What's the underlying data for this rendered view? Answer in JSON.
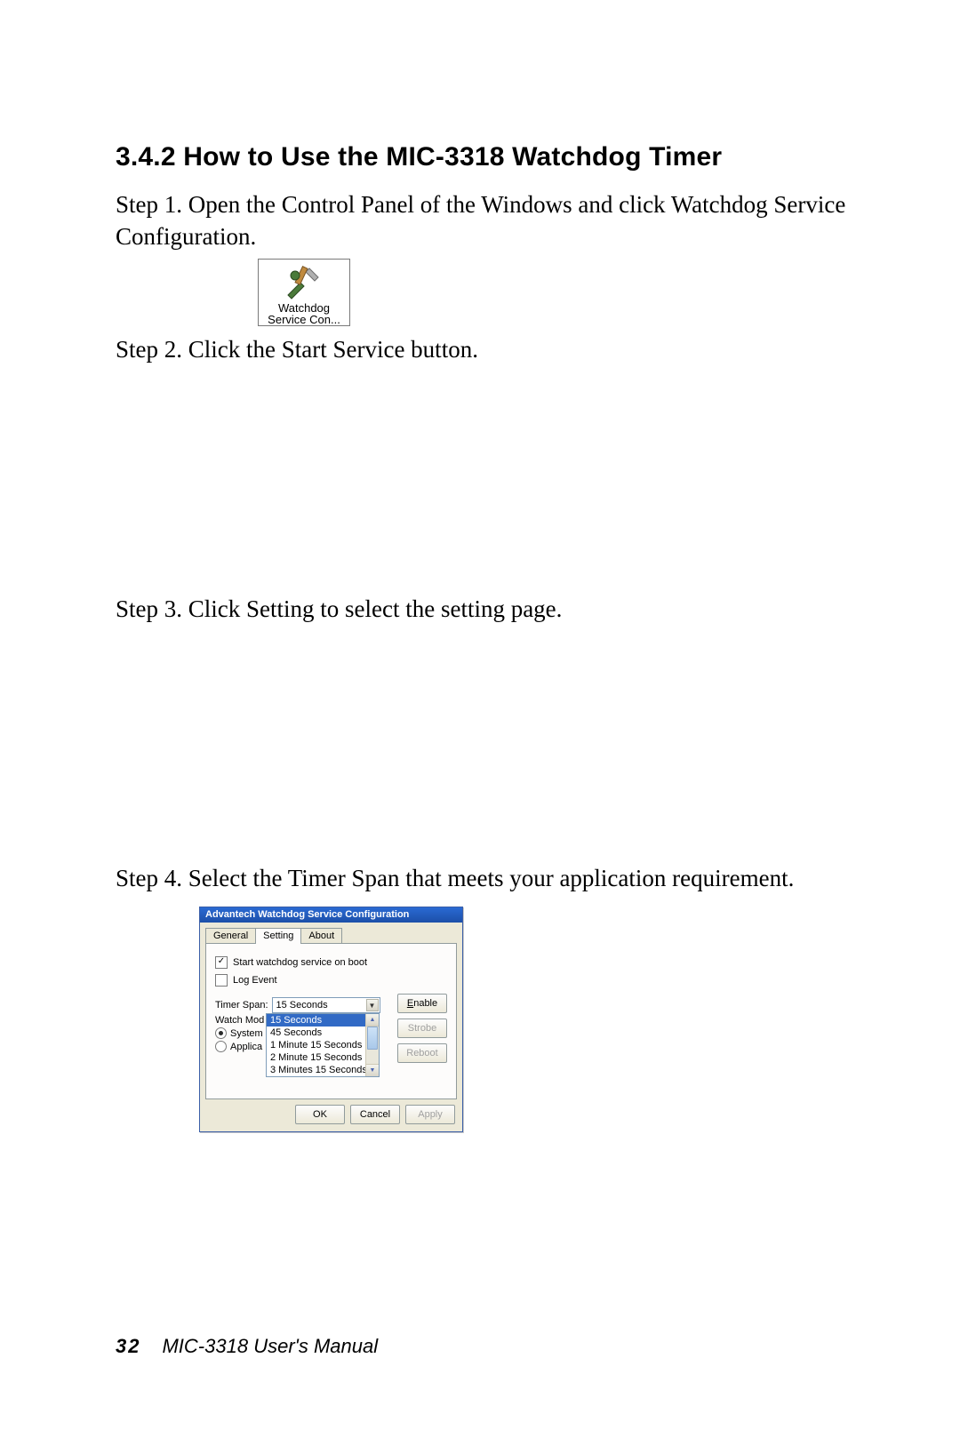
{
  "heading": "3.4.2 How to Use the MIC-3318 Watchdog Timer",
  "step1": "Step 1. Open the Control Panel of the Windows and click Watchdog Service Configuration.",
  "icon": {
    "line1": "Watchdog",
    "line2": "Service Con..."
  },
  "step2": "Step 2. Click the Start Service button.",
  "step3": "Step 3. Click Setting to select the setting page.",
  "step4": "Step 4. Select the Timer Span that meets your application requirement.",
  "dialog": {
    "title": "Advantech Watchdog Service Configuration",
    "tabs": {
      "general": "General",
      "setting": "Setting",
      "about": "About"
    },
    "chk_start_label": "Start watchdog service on boot",
    "chk_log_label": "Log Event",
    "timer_span_label": "Timer Span:",
    "combo_value": "15 Seconds",
    "options": [
      "15 Seconds",
      "45 Seconds",
      "1 Minute 15 Seconds",
      "2 Minute 15 Seconds",
      "3 Minutes 15 Seconds"
    ],
    "watch_mode_label": "Watch Mod",
    "radio_system": "System",
    "radio_application": "Applica",
    "buttons": {
      "enable": "Enable",
      "strobe": "Strobe",
      "reboot": "Reboot",
      "ok": "OK",
      "cancel": "Cancel",
      "apply": "Apply"
    }
  },
  "footer": {
    "page_number": "32",
    "text": "MIC-3318 User's Manual"
  }
}
